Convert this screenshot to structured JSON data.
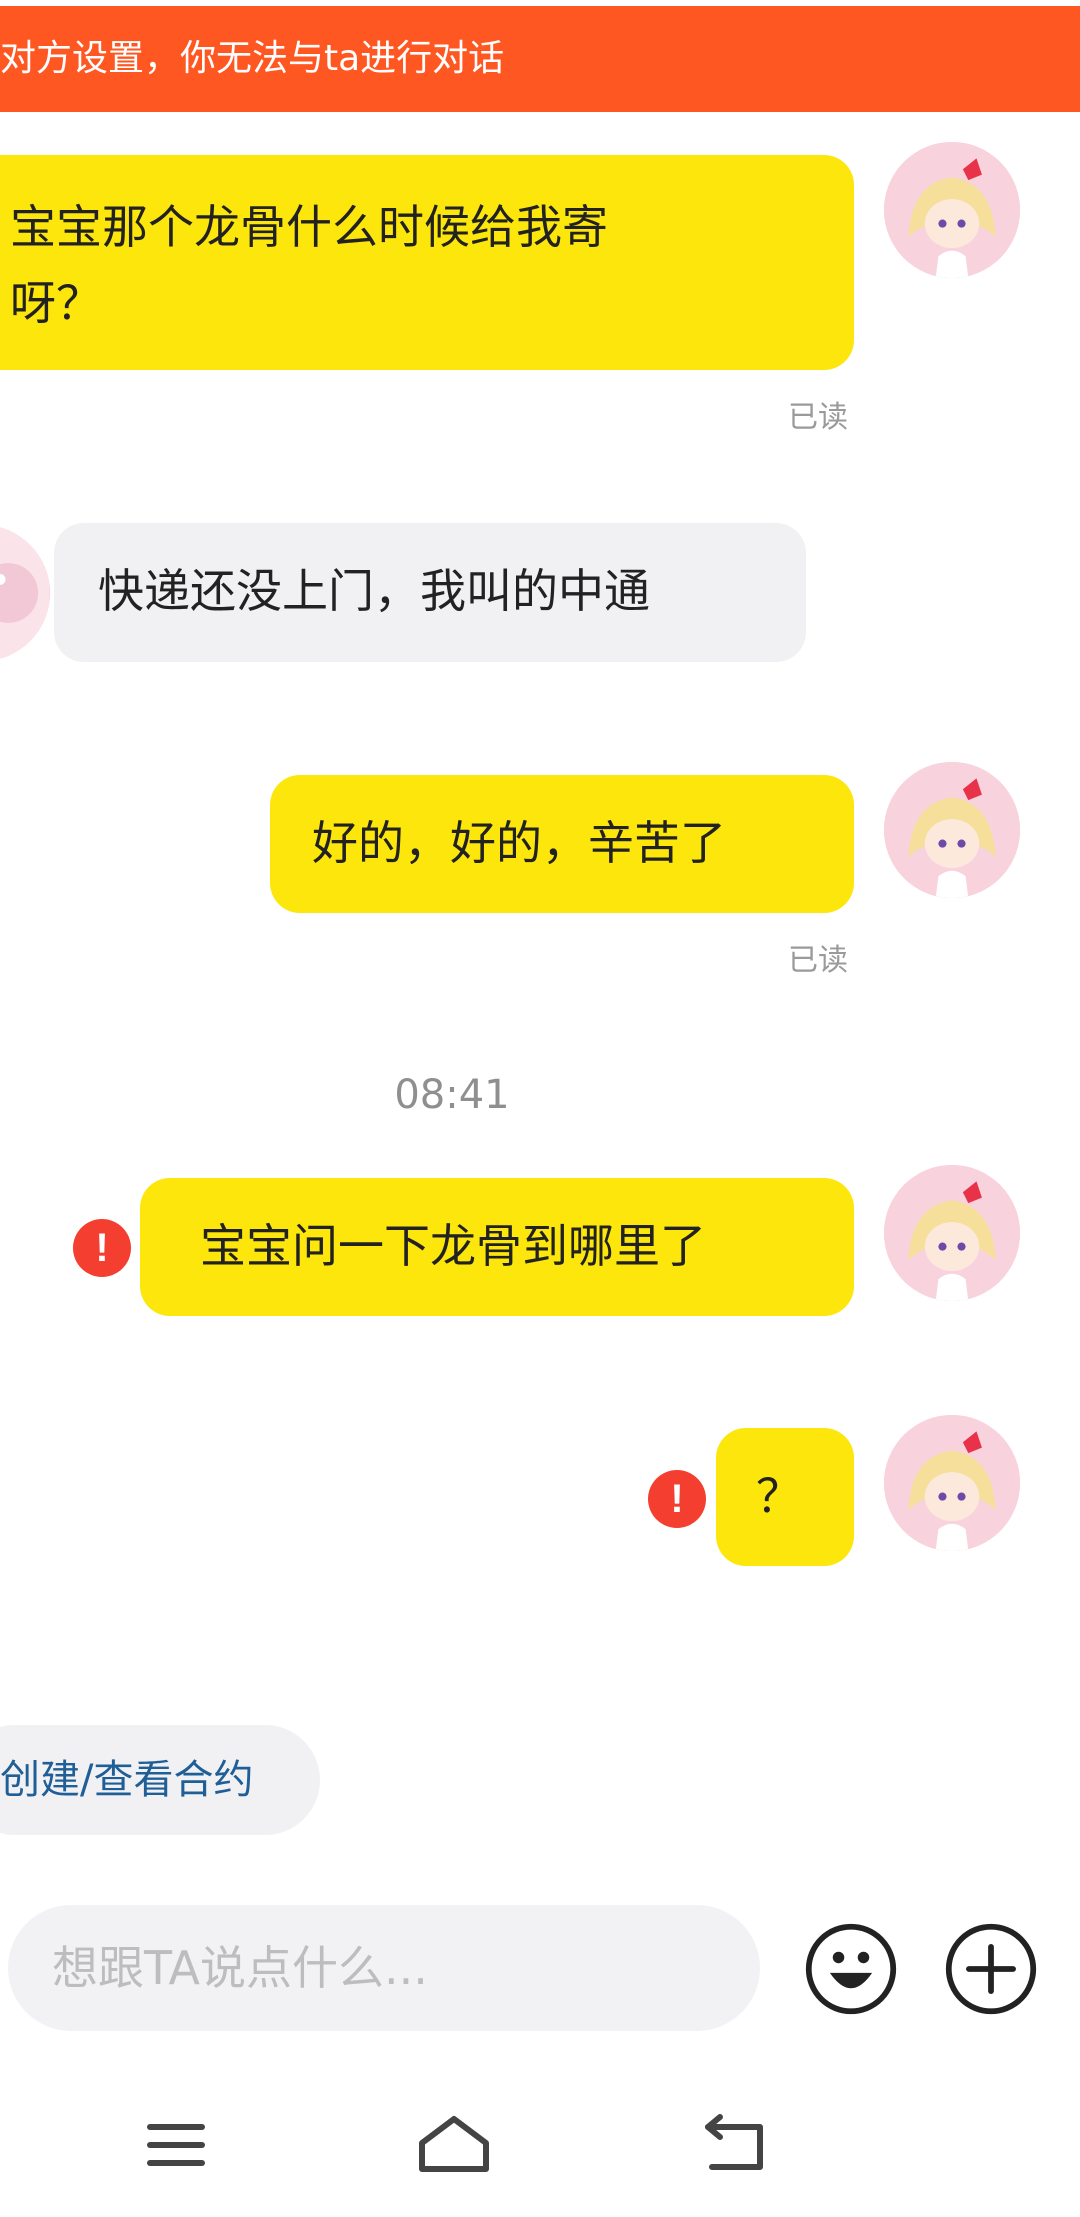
{
  "banner": {
    "text": "对方设置，你无法与ta进行对话",
    "color": "#ff5722"
  },
  "messages": [
    {
      "sender": "me",
      "text_line1": "宝宝那个龙骨什么时候给我寄",
      "text_line2": "呀？",
      "status": "已读"
    },
    {
      "sender": "partner",
      "text": "快递还没上门，我叫的中通"
    },
    {
      "sender": "me",
      "text": "好的，好的，辛苦了",
      "status": "已读"
    },
    {
      "sender": "me",
      "text": "宝宝问一下龙骨到哪里了",
      "failed": true
    },
    {
      "sender": "me",
      "text": "？",
      "failed": true
    }
  ],
  "timestamp": "08:41",
  "fail_mark": "!",
  "contract_chip": {
    "label": "创建/查看合约"
  },
  "input": {
    "placeholder": "想跟TA说点什么..."
  },
  "icons": {
    "emoji": "emoji-icon",
    "plus": "plus-icon",
    "menu": "menu-icon",
    "home": "home-icon",
    "back": "back-icon",
    "fail": "exclamation-icon",
    "avatar": "anime-avatar"
  },
  "colors": {
    "my_bubble": "#fde60b",
    "their_bubble": "#f1f1f3",
    "fail": "#f43f30",
    "link": "#1f5e96"
  }
}
